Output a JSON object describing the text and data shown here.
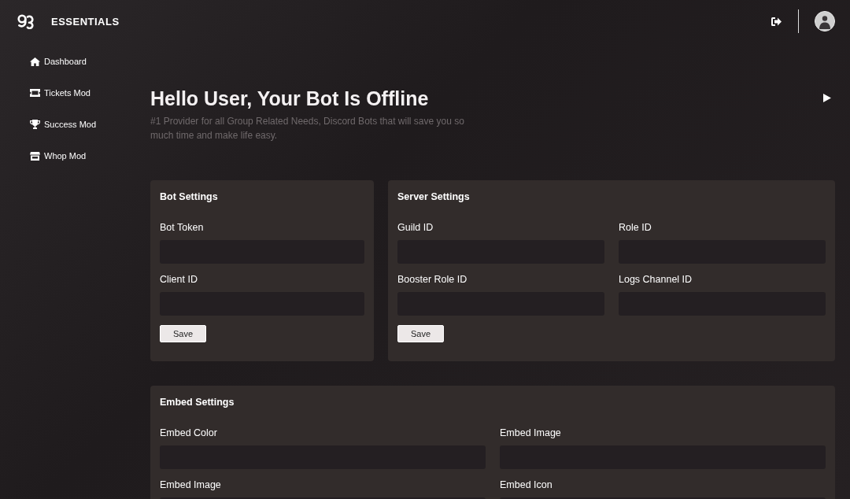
{
  "brand": {
    "name": "ESSENTIALS"
  },
  "sidebar": {
    "items": [
      {
        "label": "Dashboard"
      },
      {
        "label": "Tickets Mod"
      },
      {
        "label": "Success Mod"
      },
      {
        "label": "Whop Mod"
      }
    ]
  },
  "hero": {
    "title": "Hello User, Your Bot Is Offline",
    "subtitle": "#1 Provider for all Group Related Needs, Discord Bots that will save you so much time and make life easy."
  },
  "card_rows": [
    [
      {
        "title": "Bot Settings",
        "field_rows": [
          [
            {
              "label": "Bot Token"
            }
          ],
          [
            {
              "label": "Client ID"
            }
          ]
        ],
        "button": "Save"
      },
      {
        "title": "Server Settings",
        "field_rows": [
          [
            {
              "label": "Guild ID"
            },
            {
              "label": "Role ID"
            }
          ],
          [
            {
              "label": "Booster Role ID"
            },
            {
              "label": "Logs Channel ID"
            }
          ]
        ],
        "button": "Save"
      }
    ],
    [
      {
        "title": "Embed Settings",
        "field_rows": [
          [
            {
              "label": "Embed Color"
            },
            {
              "label": "Embed Image"
            }
          ],
          [
            {
              "label": "Embed Image"
            },
            {
              "label": "Embed Icon"
            }
          ]
        ]
      }
    ]
  ]
}
